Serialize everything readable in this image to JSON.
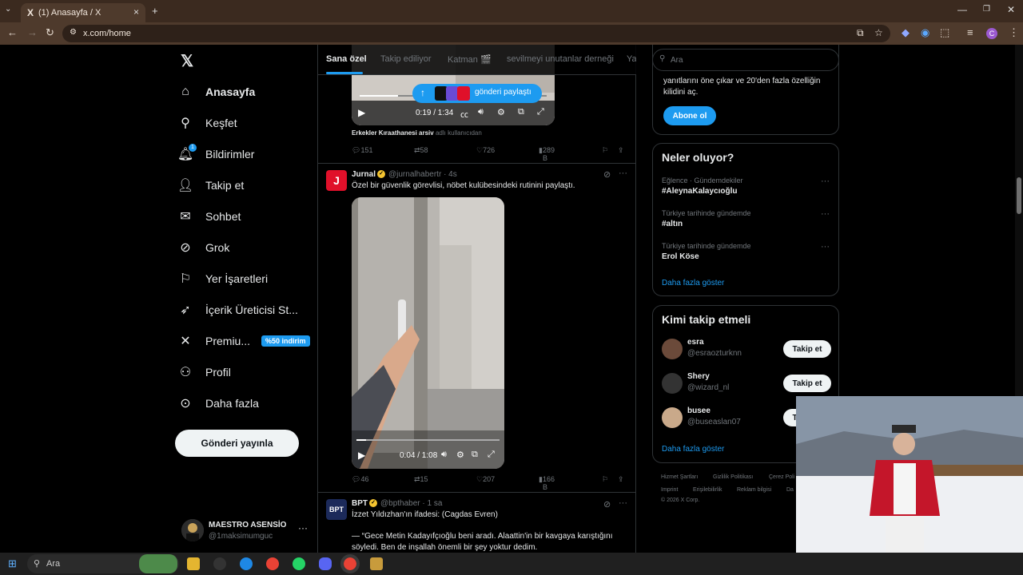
{
  "browser": {
    "tab_title": "(1) Anasayfa / X",
    "tab_logo": "X",
    "url": "x.com/home",
    "new_tab": "+",
    "close": "×"
  },
  "nav": {
    "logo": "𝕏",
    "items": [
      {
        "label": "Anasayfa",
        "icon": "home-icon"
      },
      {
        "label": "Keşfet",
        "icon": "search-icon"
      },
      {
        "label": "Bildirimler",
        "icon": "bell-icon"
      },
      {
        "label": "Takip et",
        "icon": "person-add-icon"
      },
      {
        "label": "Sohbet",
        "icon": "mail-icon"
      },
      {
        "label": "Grok",
        "icon": "grok-icon"
      },
      {
        "label": "Yer İşaretleri",
        "icon": "bookmark-icon"
      },
      {
        "label": "İçerik Üreticisi St...",
        "icon": "rocket-icon"
      },
      {
        "label": "Premiu...",
        "icon": "x-icon"
      },
      {
        "label": "Profil",
        "icon": "person-icon"
      },
      {
        "label": "Daha fazla",
        "icon": "more-circle-icon"
      }
    ],
    "notif_count": "1",
    "premium_badge": "%50 indirim",
    "post_button": "Gönderi yayınla",
    "account": {
      "name": "MAESTRO ASENSİO",
      "handle": "@1maksimumguc"
    }
  },
  "feed": {
    "tabs": [
      "Sana özel",
      "Takip ediliyor",
      "Katman 🎬",
      "sevilmeyi unutanlar derneği",
      "Ya"
    ],
    "new_posts_pill": "gönderi paylaştı",
    "tweet1": {
      "video_time": "0:19 / 1:34",
      "caption_name": "Erkekler Kıraathanesi arsiv",
      "caption_rest": "adlı kullanıcıdan",
      "replies": "151",
      "reposts": "58",
      "likes": "726",
      "views": "289 B"
    },
    "tweet2": {
      "name": "Jurnal",
      "handle": "@jurnalhabertr · 4s",
      "text": "Özel bir güvenlik görevlisi, nöbet kulübesindeki rutinini paylaştı.",
      "video_time": "0:04 / 1:08",
      "replies": "46",
      "reposts": "15",
      "likes": "207",
      "views": "166 B"
    },
    "tweet3": {
      "name": "BPT",
      "handle": "@bpthaber · 1 sa",
      "line1": "İzzet Yıldızhan'ın ifadesi: (Cagdas Evren)",
      "line2": "— “Gece Metin Kadayıfçıoğlu beni aradı. Alaattin'in bir kavgaya karıştığını",
      "line3": "söyledi. Ben de inşallah önemli bir şey yoktur dedim."
    }
  },
  "right": {
    "search_placeholder": "Ara",
    "premium_text1": "yanıtlarını öne çıkar ve 20'den fazla özelliğin",
    "premium_text2": "kilidini aç.",
    "subscribe": "Abone ol",
    "trends_title": "Neler oluyor?",
    "trends": [
      {
        "category": "Eğlence · Gündemdekiler",
        "name": "#AleynaKalaycıoğlu"
      },
      {
        "category": "Türkiye tarihinde gündemde",
        "name": "#altın"
      },
      {
        "category": "Türkiye tarihinde gündemde",
        "name": "Erol Köse"
      }
    ],
    "show_more": "Daha fazla göster",
    "who_title": "Kimi takip etmeli",
    "who": [
      {
        "name": "esra",
        "handle": "@esraozturknn",
        "button": "Takip et"
      },
      {
        "name": "Shery",
        "handle": "@wizard_nl",
        "button": "Takip et"
      },
      {
        "name": "busee",
        "handle": "@buseaslan07",
        "button": "Takip et"
      }
    ],
    "who_more": "Daha fazla göster",
    "footer": [
      "Hizmet Şartları",
      "Gizlilik Politikası",
      "Çerez Poli",
      "Imprint",
      "Erişilebilirlik",
      "Reklam bilgisi",
      "Da",
      "© 2026 X Corp."
    ]
  },
  "taskbar": {
    "search": "Ara"
  }
}
